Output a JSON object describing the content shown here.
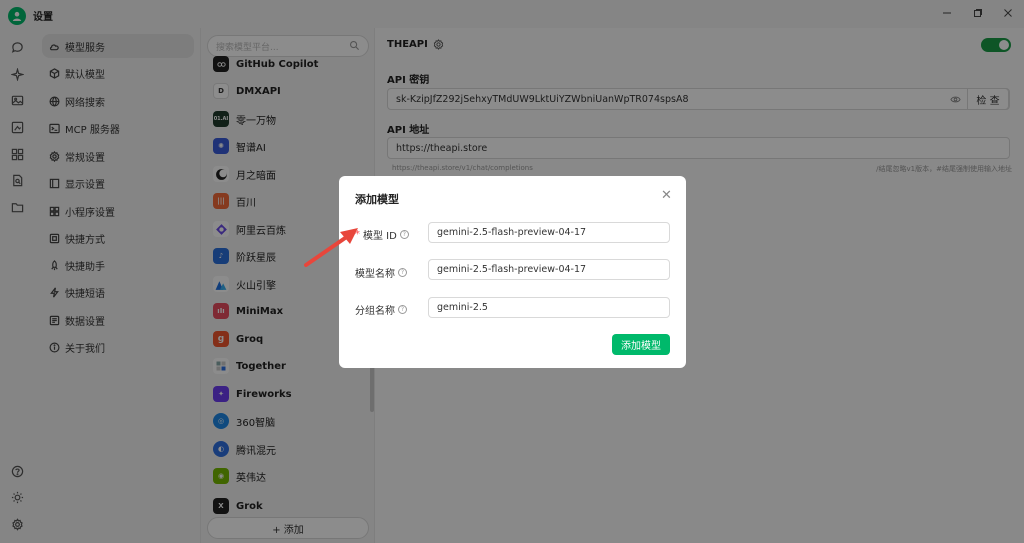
{
  "window": {
    "title": "设置",
    "controls": [
      "minimize-icon",
      "restore-icon",
      "close-icon"
    ]
  },
  "rail": {
    "top_icons": [
      "chat-icon",
      "sparkle-icon",
      "image-icon",
      "image-edit-icon",
      "apps-icon",
      "document-search-icon",
      "folder-icon"
    ],
    "bottom_icons": [
      "help-icon",
      "theme-icon",
      "settings-icon"
    ]
  },
  "nav": {
    "items": [
      {
        "label": "模型服务",
        "icon": "cloud-icon",
        "active": true
      },
      {
        "label": "默认模型",
        "icon": "cube-icon"
      },
      {
        "label": "网络搜索",
        "icon": "globe-icon"
      },
      {
        "label": "MCP 服务器",
        "icon": "terminal-icon"
      },
      {
        "label": "常规设置",
        "icon": "gear-icon"
      },
      {
        "label": "显示设置",
        "icon": "display-icon"
      },
      {
        "label": "小程序设置",
        "icon": "grid-icon"
      },
      {
        "label": "快捷方式",
        "icon": "command-icon"
      },
      {
        "label": "快捷助手",
        "icon": "rocket-icon"
      },
      {
        "label": "快捷短语",
        "icon": "zap-icon"
      },
      {
        "label": "数据设置",
        "icon": "database-icon"
      },
      {
        "label": "关于我们",
        "icon": "info-icon"
      }
    ]
  },
  "providers": {
    "search_placeholder": "搜索模型平台...",
    "items": [
      {
        "label": "GitHub Copilot",
        "logo": "CP",
        "color": "#222222"
      },
      {
        "label": "DMXAPI",
        "logo": "D",
        "color": "#ffffff"
      },
      {
        "label": "零一万物",
        "logo": "01.AI",
        "color": "#1f3b2d"
      },
      {
        "label": "智谱AI",
        "logo": "Z",
        "color": "#3a5bd9"
      },
      {
        "label": "月之暗面",
        "logo": "M",
        "color": "#ffffff"
      },
      {
        "label": "百川",
        "logo": "B",
        "color": "#f26b3a"
      },
      {
        "label": "阿里云百炼",
        "logo": "Q",
        "color": "#ffffff"
      },
      {
        "label": "阶跃星辰",
        "logo": "S",
        "color": "#2a6fdb"
      },
      {
        "label": "火山引擎",
        "logo": "V",
        "color": "#ffffff"
      },
      {
        "label": "MiniMax",
        "logo": "M",
        "color": "#e84d5f"
      },
      {
        "label": "Groq",
        "logo": "g",
        "color": "#f1572f"
      },
      {
        "label": "Together",
        "logo": "T",
        "color": "#ffffff"
      },
      {
        "label": "Fireworks",
        "logo": "F",
        "color": "#6c3cf0"
      },
      {
        "label": "360智脑",
        "logo": "360",
        "color": "#1e88e5"
      },
      {
        "label": "腾讯混元",
        "logo": "H",
        "color": "#2f6fe0"
      },
      {
        "label": "英伟达",
        "logo": "N",
        "color": "#76b900"
      },
      {
        "label": "Grok",
        "logo": "X",
        "color": "#222222"
      }
    ],
    "add_label": "+ 添加"
  },
  "detail": {
    "provider_name": "THEAPI",
    "enabled": true,
    "api_key_label": "API 密钥",
    "api_key_value": "sk-KzipJfZ292jSehxyTMdUW9LktUiYZWbniUanWpTR074spsA8",
    "check_label": "检 查",
    "api_url_label": "API 地址",
    "api_url_value": "https://theapi.store",
    "api_url_preview": "https://theapi.store/v1/chat/completions",
    "api_url_hint": "/结尾忽略v1版本，#结尾强制使用输入地址"
  },
  "dialog": {
    "title": "添加模型",
    "fields": [
      {
        "label": "模型 ID",
        "required": true,
        "value": "gemini-2.5-flash-preview-04-17"
      },
      {
        "label": "模型名称",
        "required": false,
        "value": "gemini-2.5-flash-preview-04-17"
      },
      {
        "label": "分组名称",
        "required": false,
        "value": "gemini-2.5"
      }
    ],
    "submit_label": "添加模型"
  },
  "colors": {
    "accent": "#00b96b",
    "toggle": "#1a9b46",
    "annotation_arrow": "#e8463b"
  }
}
